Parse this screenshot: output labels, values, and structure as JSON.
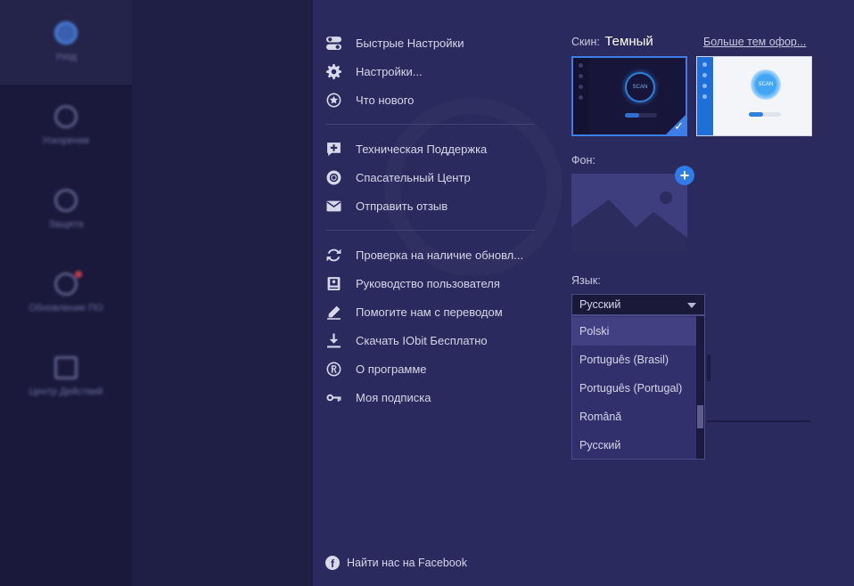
{
  "background_app": {
    "nav": [
      {
        "label": "Уход",
        "active": true
      },
      {
        "label": "Ускорение",
        "active": false
      },
      {
        "label": "Защита",
        "active": false
      },
      {
        "label": "Обновление ПО",
        "active": false
      },
      {
        "label": "Центр Действий",
        "active": false
      }
    ]
  },
  "menu": {
    "group1": [
      {
        "label": "Быстрые Настройки",
        "icon": "toggles-icon"
      },
      {
        "label": "Настройки...",
        "icon": "gear-icon"
      },
      {
        "label": "Что нового",
        "icon": "star-icon"
      }
    ],
    "group2": [
      {
        "label": "Техническая Поддержка",
        "icon": "support-plus-icon"
      },
      {
        "label": "Спасательный Центр",
        "icon": "lifebuoy-icon"
      },
      {
        "label": "Отправить отзыв",
        "icon": "envelope-icon"
      }
    ],
    "group3": [
      {
        "label": "Проверка на наличие обновл...",
        "icon": "refresh-icon"
      },
      {
        "label": "Руководство пользователя",
        "icon": "manual-icon"
      },
      {
        "label": "Помогите нам с переводом",
        "icon": "pencil-icon"
      },
      {
        "label": "Скачать IObit Бесплатно",
        "icon": "download-icon"
      },
      {
        "label": "О программе",
        "icon": "registered-icon"
      },
      {
        "label": "Моя подписка",
        "icon": "key-icon"
      }
    ],
    "facebook": {
      "label": "Найти нас на Facebook",
      "icon": "facebook-icon"
    }
  },
  "skin": {
    "label": "Скин:",
    "value": "Темный",
    "more_link": "Больше тем офор...",
    "thumb_text": "SCAN",
    "selected": "dark"
  },
  "background": {
    "label": "Фон:",
    "add_symbol": "+"
  },
  "language": {
    "label": "Язык:",
    "selected": "Русский",
    "options": [
      "Polski",
      "Português (Brasil)",
      "Português (Portugal)",
      "Română",
      "Русский"
    ],
    "highlighted": "Polski"
  },
  "colors": {
    "panel_bg": "#2b2a5f",
    "accent": "#3c7ee6",
    "text": "#d6d6ea"
  }
}
